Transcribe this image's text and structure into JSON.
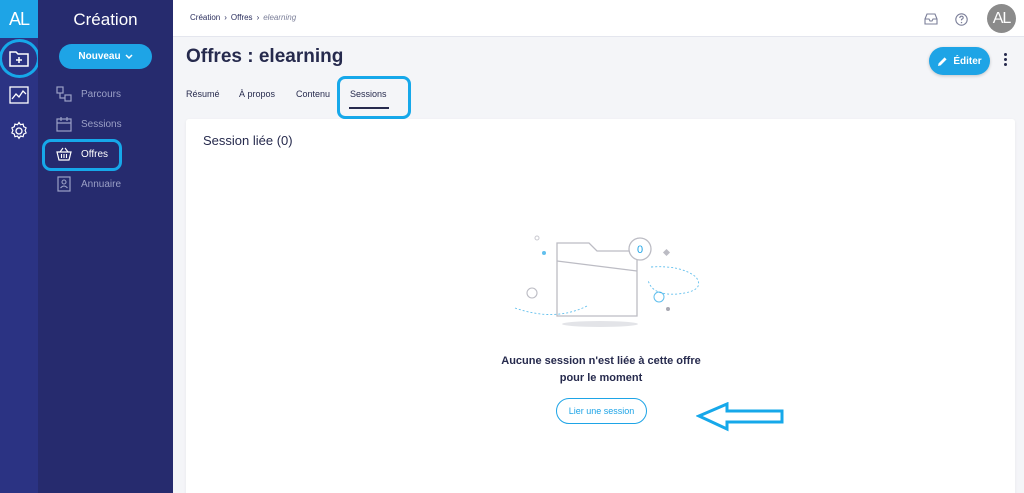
{
  "app": {
    "logo": "AL",
    "section_title": "Création"
  },
  "rail": {
    "items": [
      {
        "icon": "folder-plus-icon"
      },
      {
        "icon": "chart-line-icon"
      },
      {
        "icon": "gear-icon"
      }
    ]
  },
  "sidebar": {
    "new_button_label": "Nouveau",
    "items": [
      {
        "label": "Parcours",
        "icon": "path-icon"
      },
      {
        "label": "Sessions",
        "icon": "calendar-icon"
      },
      {
        "label": "Offres",
        "icon": "basket-icon",
        "active": true
      },
      {
        "label": "Annuaire",
        "icon": "contact-book-icon"
      }
    ]
  },
  "breadcrumb": {
    "items": [
      "Création",
      "Offres"
    ],
    "current": "elearning"
  },
  "header": {
    "avatar_initials": "AL"
  },
  "page": {
    "title": "Offres : elearning",
    "edit_label": "Éditer",
    "tabs": [
      {
        "label": "Résumé"
      },
      {
        "label": "À propos"
      },
      {
        "label": "Contenu"
      },
      {
        "label": "Sessions",
        "active": true
      }
    ]
  },
  "card": {
    "title": "Session liée (0)",
    "badge_count": "0",
    "empty_line1": "Aucune session n'est liée à cette offre",
    "empty_line2": "pour le moment",
    "link_button_label": "Lier une session"
  },
  "colors": {
    "accent": "#1ea4e6",
    "rail": "#2b3383",
    "sidebar": "#262b6e",
    "text": "#262a4d"
  }
}
